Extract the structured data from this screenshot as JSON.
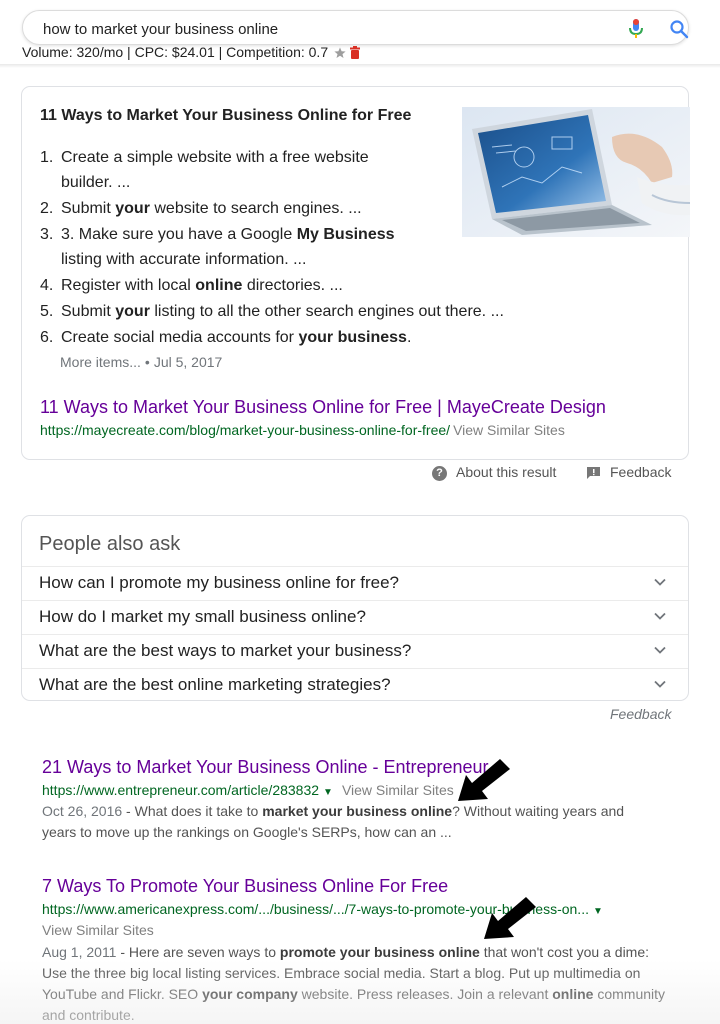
{
  "search": {
    "query": "how to market your business online",
    "stats": "Volume: 320/mo | CPC: $24.01 | Competition: 0.7"
  },
  "featured": {
    "title": "11 Ways to Market Your Business Online for Free",
    "list": [
      {
        "num": "1.",
        "text": "Create a simple website with a free website builder. ..."
      },
      {
        "num": "2.",
        "pre": "Submit ",
        "bold": "your",
        "post": " website to search engines. ..."
      },
      {
        "num": "3.",
        "pre": "3. Make sure you have a Google ",
        "bold": "My Business",
        "post": " listing with accurate information. ..."
      },
      {
        "num": "4.",
        "pre": "Register with local ",
        "bold": "online",
        "post": " directories. ..."
      },
      {
        "num": "5.",
        "pre": "Submit ",
        "bold": "your",
        "post": " listing to all the other search engines out there. ..."
      },
      {
        "num": "6.",
        "pre": "Create social media accounts for ",
        "bold": "your business",
        "post": "."
      }
    ],
    "more_items": "More items...",
    "date": "Jul 5, 2017",
    "link_title": "11 Ways to Market Your Business Online for Free | MayeCreate Design",
    "url": "https://mayecreate.com/blog/market-your-business-online-for-free/",
    "similar": "View Similar Sites"
  },
  "about": {
    "about_label": "About this result",
    "feedback_label": "Feedback"
  },
  "paa": {
    "heading": "People also ask",
    "questions": [
      "How can I promote my business online for free?",
      "How do I market my small business online?",
      "What are the best ways to market your business?",
      "What are the best online marketing strategies?"
    ],
    "feedback": "Feedback"
  },
  "results": [
    {
      "title": "21 Ways to Market Your Business Online - Entrepreneur",
      "url": "https://www.entrepreneur.com/article/283832",
      "similar": "View Similar Sites",
      "date": "Oct 26, 2016",
      "snippet_pre": " - What does it take to ",
      "snippet_bold": "market your business online",
      "snippet_post": "? Without waiting years and years to move up the rankings on Google's SERPs, how can an ..."
    },
    {
      "title": "7 Ways To Promote Your Business Online For Free",
      "url": "https://www.americanexpress.com/.../business/.../7-ways-to-promote-your-business-on...",
      "similar": "View Similar Sites",
      "date": "Aug 1, 2011",
      "snippet_a": " - Here are seven ways to ",
      "snippet_b": "promote your business online",
      "snippet_c": " that won't cost you a dime: Use the three big local listing services. Embrace social media. Start a blog. Put up multimedia on YouTube and Flickr. SEO ",
      "snippet_d": "your company",
      "snippet_e": " website. Press releases. Join a relevant ",
      "snippet_f": "online",
      "snippet_g": " community and contribute."
    }
  ],
  "colors": {
    "visited_link": "#660099",
    "url_green": "#006621",
    "mic_blue": "#4285f4",
    "mic_red": "#ea4335"
  }
}
